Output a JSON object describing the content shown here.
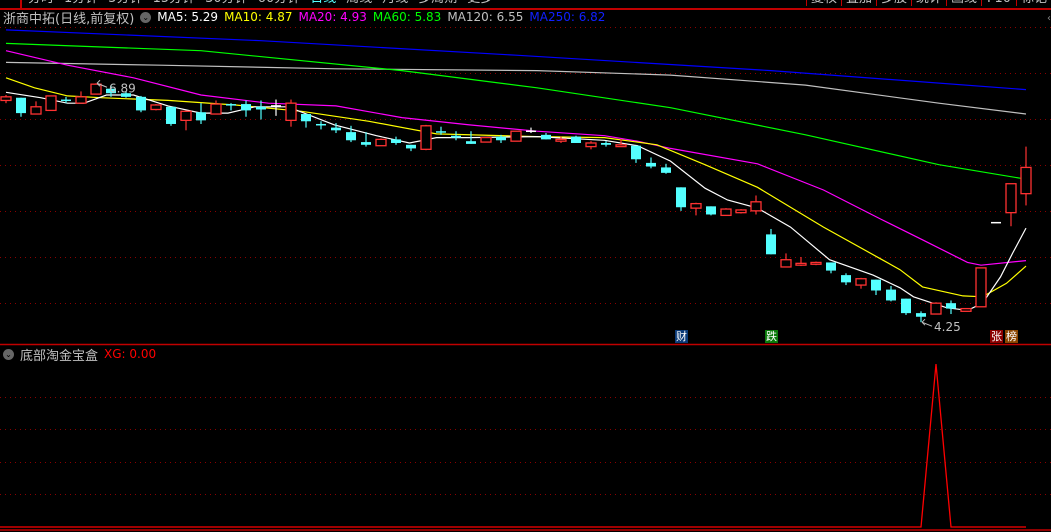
{
  "toolbar": {
    "periods": [
      "分时",
      "1分钟",
      "5分钟",
      "15分钟",
      "30分钟",
      "60分钟",
      "日线",
      "周线",
      "月线",
      "多周期",
      "更多"
    ],
    "active_period": "日线",
    "tools": [
      "复权",
      "叠加",
      "多股",
      "统计",
      "画线",
      "F10",
      "标记"
    ]
  },
  "legend": {
    "title": "浙商中拓(日线,前复权)",
    "ma5": "MA5: 5.29",
    "ma10": "MA10: 4.87",
    "ma20": "MA20: 4.93",
    "ma60": "MA60: 5.83",
    "ma120": "MA120: 6.55",
    "ma250": "MA250: 6.82"
  },
  "indicator": {
    "title": "底部淘金宝盒",
    "value": "XG: 0.00"
  },
  "badges": [
    {
      "label": "财",
      "color": "#0a3a78",
      "index": 45
    },
    {
      "label": "跌",
      "color": "#0a7a0a",
      "index": 51
    },
    {
      "label": "张",
      "color": "#8b0000",
      "index": 66
    },
    {
      "label": "榜",
      "color": "#8b4500",
      "index": 67
    }
  ],
  "colors": {
    "up": "#ff3232",
    "down": "#54ffff",
    "doji": "#ffffff",
    "ma5": "#ffffff",
    "ma10": "#ffff00",
    "ma20": "#ff00ff",
    "ma60": "#00ff00",
    "ma120": "#c0c0c0",
    "ma250": "#0000ff",
    "grid": "#8b0000"
  },
  "chart_data": {
    "type": "candlestick",
    "price_range": [
      4.25,
      7.5
    ],
    "annotations": [
      {
        "label": "6.89",
        "index": 6,
        "kind": "high"
      },
      {
        "label": "4.25",
        "index": 61,
        "kind": "low"
      }
    ],
    "candles": [
      [
        6.7,
        6.74,
        6.76,
        6.67
      ],
      [
        6.73,
        6.56,
        6.73,
        6.52
      ],
      [
        6.55,
        6.63,
        6.69,
        6.55
      ],
      [
        6.59,
        6.75,
        6.75,
        6.59
      ],
      [
        6.71,
        6.7,
        6.74,
        6.67
      ],
      [
        6.67,
        6.74,
        6.8,
        6.67
      ],
      [
        6.77,
        6.88,
        6.89,
        6.77
      ],
      [
        6.83,
        6.78,
        6.87,
        6.74
      ],
      [
        6.78,
        6.74,
        6.8,
        6.73
      ],
      [
        6.74,
        6.59,
        6.75,
        6.57
      ],
      [
        6.6,
        6.65,
        6.66,
        6.59
      ],
      [
        6.63,
        6.44,
        6.63,
        6.42
      ],
      [
        6.48,
        6.58,
        6.59,
        6.37
      ],
      [
        6.57,
        6.48,
        6.67,
        6.44
      ],
      [
        6.55,
        6.66,
        6.7,
        6.55
      ],
      [
        6.66,
        6.65,
        6.67,
        6.59
      ],
      [
        6.66,
        6.59,
        6.7,
        6.52
      ],
      [
        6.63,
        6.6,
        6.7,
        6.49
      ],
      [
        6.64,
        6.64,
        6.71,
        6.53
      ],
      [
        6.48,
        6.67,
        6.71,
        6.41
      ],
      [
        6.55,
        6.47,
        6.55,
        6.4
      ],
      [
        6.44,
        6.43,
        6.47,
        6.38
      ],
      [
        6.4,
        6.37,
        6.45,
        6.34
      ],
      [
        6.35,
        6.26,
        6.42,
        6.24
      ],
      [
        6.24,
        6.21,
        6.35,
        6.19
      ],
      [
        6.2,
        6.27,
        6.28,
        6.2
      ],
      [
        6.27,
        6.23,
        6.3,
        6.21
      ],
      [
        6.21,
        6.17,
        6.21,
        6.14
      ],
      [
        6.16,
        6.42,
        6.43,
        6.15
      ],
      [
        6.36,
        6.35,
        6.41,
        6.32
      ],
      [
        6.31,
        6.29,
        6.36,
        6.26
      ],
      [
        6.25,
        6.22,
        6.36,
        6.22
      ],
      [
        6.24,
        6.29,
        6.3,
        6.24
      ],
      [
        6.3,
        6.26,
        6.32,
        6.23
      ],
      [
        6.25,
        6.36,
        6.36,
        6.25
      ],
      [
        6.36,
        6.36,
        6.4,
        6.34
      ],
      [
        6.32,
        6.27,
        6.34,
        6.27
      ],
      [
        6.25,
        6.27,
        6.3,
        6.23
      ],
      [
        6.3,
        6.23,
        6.31,
        6.23
      ],
      [
        6.19,
        6.23,
        6.25,
        6.16
      ],
      [
        6.23,
        6.21,
        6.25,
        6.19
      ],
      [
        6.19,
        6.21,
        6.27,
        6.19
      ],
      [
        6.2,
        6.05,
        6.2,
        6.01
      ],
      [
        6.01,
        5.97,
        6.07,
        5.95
      ],
      [
        5.96,
        5.9,
        6.0,
        5.89
      ],
      [
        5.74,
        5.52,
        5.74,
        5.48
      ],
      [
        5.51,
        5.56,
        5.57,
        5.43
      ],
      [
        5.53,
        5.44,
        5.53,
        5.43
      ],
      [
        5.43,
        5.5,
        5.51,
        5.43
      ],
      [
        5.46,
        5.49,
        5.5,
        5.45
      ],
      [
        5.48,
        5.58,
        5.65,
        5.44
      ],
      [
        5.22,
        5.0,
        5.28,
        5.0
      ],
      [
        4.86,
        4.94,
        5.01,
        4.86
      ],
      [
        4.88,
        4.9,
        4.97,
        4.87
      ],
      [
        4.89,
        4.91,
        4.92,
        4.88
      ],
      [
        4.91,
        4.82,
        4.91,
        4.79
      ],
      [
        4.77,
        4.69,
        4.79,
        4.66
      ],
      [
        4.66,
        4.73,
        4.74,
        4.62
      ],
      [
        4.72,
        4.6,
        4.72,
        4.55
      ],
      [
        4.61,
        4.49,
        4.65,
        4.48
      ],
      [
        4.51,
        4.35,
        4.51,
        4.33
      ],
      [
        4.35,
        4.31,
        4.37,
        4.25
      ],
      [
        4.34,
        4.46,
        4.47,
        4.34
      ],
      [
        4.46,
        4.4,
        4.49,
        4.34
      ],
      [
        4.37,
        4.4,
        4.4,
        4.37
      ],
      [
        4.42,
        4.85,
        4.85,
        4.42
      ],
      [
        5.35,
        5.35,
        5.35,
        5.35
      ],
      [
        5.46,
        5.78,
        5.78,
        5.31
      ],
      [
        5.67,
        5.96,
        6.19,
        5.54
      ]
    ],
    "candle_fields": [
      "open",
      "close",
      "high",
      "low"
    ],
    "ma_lines": {
      "ma250": [
        [
          0,
          7.48
        ],
        [
          17,
          7.36
        ],
        [
          34,
          7.2
        ],
        [
          51,
          7.03
        ],
        [
          68,
          6.82
        ]
      ],
      "ma120": [
        [
          0,
          7.12
        ],
        [
          10.3,
          7.09
        ],
        [
          22,
          7.05
        ],
        [
          35.4,
          7.03
        ],
        [
          44.3,
          6.98
        ],
        [
          53.3,
          6.87
        ],
        [
          62.2,
          6.67
        ],
        [
          68,
          6.55
        ]
      ],
      "ma60": [
        [
          0,
          7.33
        ],
        [
          13,
          7.25
        ],
        [
          26.4,
          7.03
        ],
        [
          35.4,
          6.84
        ],
        [
          44.3,
          6.62
        ],
        [
          53.3,
          6.32
        ],
        [
          62.2,
          5.99
        ],
        [
          68,
          5.83
        ]
      ],
      "ma20": [
        [
          0,
          7.25
        ],
        [
          4.1,
          7.09
        ],
        [
          8.5,
          6.95
        ],
        [
          13,
          6.76
        ],
        [
          17.5,
          6.67
        ],
        [
          22,
          6.64
        ],
        [
          26.4,
          6.51
        ],
        [
          30.9,
          6.43
        ],
        [
          35.4,
          6.36
        ],
        [
          39.9,
          6.31
        ],
        [
          42.1,
          6.25
        ],
        [
          44.3,
          6.17
        ],
        [
          50.1,
          6.0
        ],
        [
          54.5,
          5.71
        ],
        [
          58.3,
          5.39
        ],
        [
          61.1,
          5.16
        ],
        [
          64.1,
          4.91
        ],
        [
          65,
          4.88
        ],
        [
          68,
          4.93
        ]
      ],
      "ma10": [
        [
          0,
          6.95
        ],
        [
          1.9,
          6.84
        ],
        [
          4.1,
          6.75
        ],
        [
          6.3,
          6.73
        ],
        [
          10.8,
          6.7
        ],
        [
          15.3,
          6.65
        ],
        [
          19.7,
          6.58
        ],
        [
          24.2,
          6.47
        ],
        [
          28.7,
          6.33
        ],
        [
          35.4,
          6.3
        ],
        [
          39.9,
          6.29
        ],
        [
          43.4,
          6.21
        ],
        [
          46.6,
          5.99
        ],
        [
          50.1,
          5.74
        ],
        [
          54.5,
          5.3
        ],
        [
          58.3,
          4.95
        ],
        [
          59.6,
          4.83
        ],
        [
          61.1,
          4.64
        ],
        [
          63.8,
          4.54
        ],
        [
          65.1,
          4.53
        ],
        [
          66.7,
          4.68
        ],
        [
          68,
          4.87
        ]
      ],
      "ma5": [
        [
          0,
          6.79
        ],
        [
          2.3,
          6.73
        ],
        [
          4.1,
          6.67
        ],
        [
          5.2,
          6.67
        ],
        [
          6.7,
          6.76
        ],
        [
          8.5,
          6.76
        ],
        [
          10.8,
          6.64
        ],
        [
          13,
          6.56
        ],
        [
          14.8,
          6.56
        ],
        [
          16.6,
          6.63
        ],
        [
          18.8,
          6.63
        ],
        [
          21.9,
          6.43
        ],
        [
          24.7,
          6.31
        ],
        [
          26.9,
          6.23
        ],
        [
          28.7,
          6.29
        ],
        [
          30.9,
          6.29
        ],
        [
          35.4,
          6.3
        ],
        [
          39.9,
          6.26
        ],
        [
          42.1,
          6.2
        ],
        [
          44.3,
          6.03
        ],
        [
          46.6,
          5.73
        ],
        [
          48.1,
          5.6
        ],
        [
          50.1,
          5.51
        ],
        [
          52.3,
          5.3
        ],
        [
          54.9,
          4.94
        ],
        [
          57.8,
          4.77
        ],
        [
          59.6,
          4.63
        ],
        [
          60.5,
          4.53
        ],
        [
          62.7,
          4.41
        ],
        [
          64.1,
          4.38
        ],
        [
          65.1,
          4.46
        ],
        [
          66.3,
          4.75
        ],
        [
          67.1,
          5.01
        ],
        [
          68,
          5.29
        ]
      ]
    },
    "indicator_series": {
      "name": "XG",
      "signal_index": 62,
      "value": 1,
      "range": [
        0,
        1
      ]
    }
  }
}
